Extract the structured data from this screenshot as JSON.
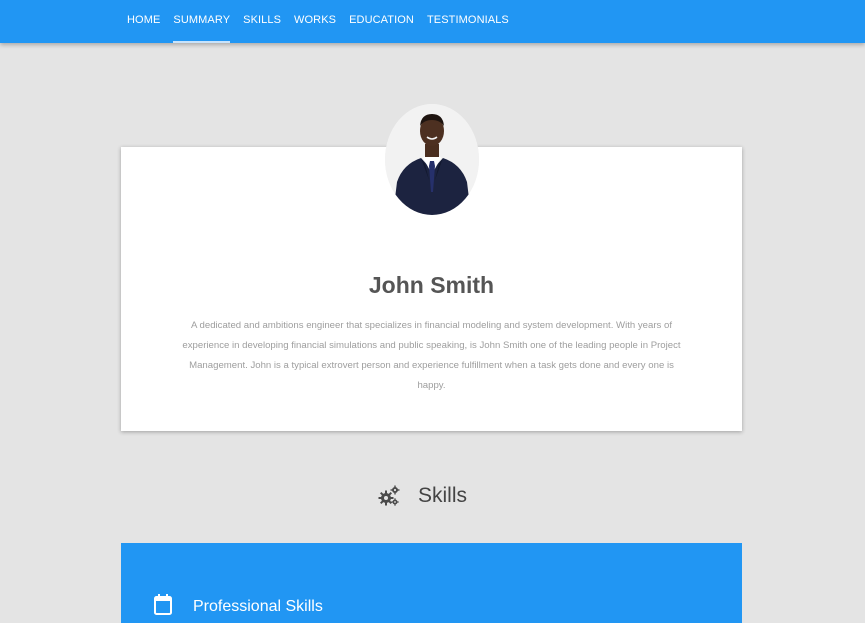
{
  "nav": {
    "items": [
      {
        "label": "HOME",
        "active": false
      },
      {
        "label": "SUMMARY",
        "active": true
      },
      {
        "label": "SKILLS",
        "active": false
      },
      {
        "label": "WORKS",
        "active": false
      },
      {
        "label": "EDUCATION",
        "active": false
      },
      {
        "label": "TESTIMONIALS",
        "active": false
      }
    ]
  },
  "profile": {
    "name": "John Smith",
    "bio": "A dedicated and ambitions engineer that specializes in financial modeling and system development. With years of experience in developing financial simulations and public speaking, is John Smith one of the leading people in Project Management. John is a typical extrovert person and experience fulfillment when a task gets done and every one is happy."
  },
  "skills": {
    "heading": "Skills",
    "heading_icon": "gears-icon",
    "panel_title": "Professional Skills",
    "panel_icon": "calendar-icon"
  },
  "colors": {
    "primary": "#2196f3",
    "background": "#e4e4e4",
    "card": "#ffffff"
  }
}
